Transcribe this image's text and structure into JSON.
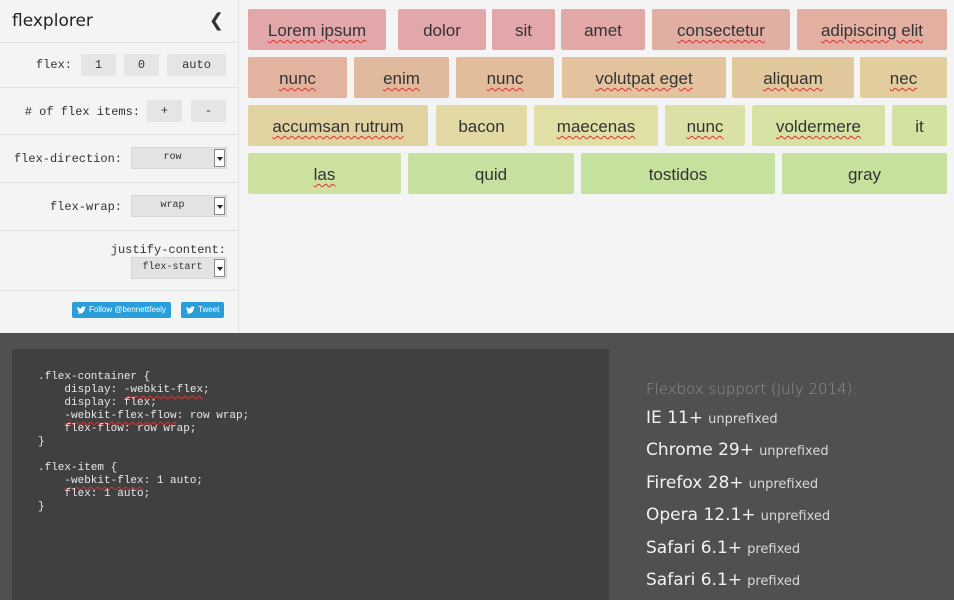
{
  "sidebar": {
    "title": "flexplorer",
    "collapse_icon": "chevron-left-icon",
    "flex": {
      "label": "flex:",
      "grow": "1",
      "shrink": "0",
      "basis": "auto"
    },
    "items": {
      "label": "# of flex items:",
      "add": "+",
      "remove": "-"
    },
    "direction": {
      "label": "flex-direction:",
      "value": "row"
    },
    "wrap": {
      "label": "flex-wrap:",
      "value": "wrap"
    },
    "justify": {
      "label": "justify-content:",
      "value": "flex-start"
    },
    "social": {
      "follow": "Follow @bennettfeely",
      "tweet": "Tweet",
      "brand_color": "#2a9ed9"
    }
  },
  "flex_items": [
    {
      "label": "Lorem ipsum",
      "color": "#e1a7a9"
    },
    {
      "label": "dolor",
      "color": "#e1a7a9"
    },
    {
      "label": "sit",
      "color": "#e1a7a9"
    },
    {
      "label": "amet",
      "color": "#e1a8a6"
    },
    {
      "label": "consectetur",
      "color": "#e1aea3"
    },
    {
      "label": "adipiscing elit",
      "color": "#e2afa1"
    },
    {
      "label": "nunc",
      "color": "#e2b49f"
    },
    {
      "label": "enim",
      "color": "#e1b99c"
    },
    {
      "label": "nunc",
      "color": "#e1bd9c"
    },
    {
      "label": "volutpat eget",
      "color": "#e2c39e"
    },
    {
      "label": "aliquam",
      "color": "#e1c79c"
    },
    {
      "label": "nec",
      "color": "#e1cd9d"
    },
    {
      "label": "accumsan rutrum",
      "color": "#e0d3a1"
    },
    {
      "label": "bacon",
      "color": "#e2d9a4"
    },
    {
      "label": "maecenas",
      "color": "#dfdfa6"
    },
    {
      "label": "nunc",
      "color": "#dbe1a6"
    },
    {
      "label": "voldermere",
      "color": "#d6e2a4"
    },
    {
      "label": "it",
      "color": "#d2e3a1"
    },
    {
      "label": "las",
      "color": "#cde2a0"
    },
    {
      "label": "quid",
      "color": "#c6e19f"
    },
    {
      "label": "tostidos",
      "color": "#c5e19e"
    },
    {
      "label": "gray",
      "color": "#c5e19d"
    }
  ],
  "code": {
    "lines": [
      ".flex-container {",
      "    display: -webkit-flex;",
      "    display: flex;",
      "    -webkit-flex-flow: row wrap;",
      "    flex-flow: row wrap;",
      "}",
      "",
      ".flex-item {",
      "    -webkit-flex: 1 auto;",
      "    flex: 1 auto;",
      "}"
    ]
  },
  "support": {
    "title": "Flexbox support (July 2014):",
    "browsers": [
      {
        "name": "IE 11+",
        "note": "unprefixed"
      },
      {
        "name": "Chrome 29+",
        "note": "unprefixed"
      },
      {
        "name": "Firefox 28+",
        "note": "unprefixed"
      },
      {
        "name": "Opera 12.1+",
        "note": "unprefixed"
      },
      {
        "name": "Safari 6.1+",
        "note": "prefixed"
      },
      {
        "name": "Safari 6.1+",
        "note": "prefixed"
      }
    ]
  }
}
